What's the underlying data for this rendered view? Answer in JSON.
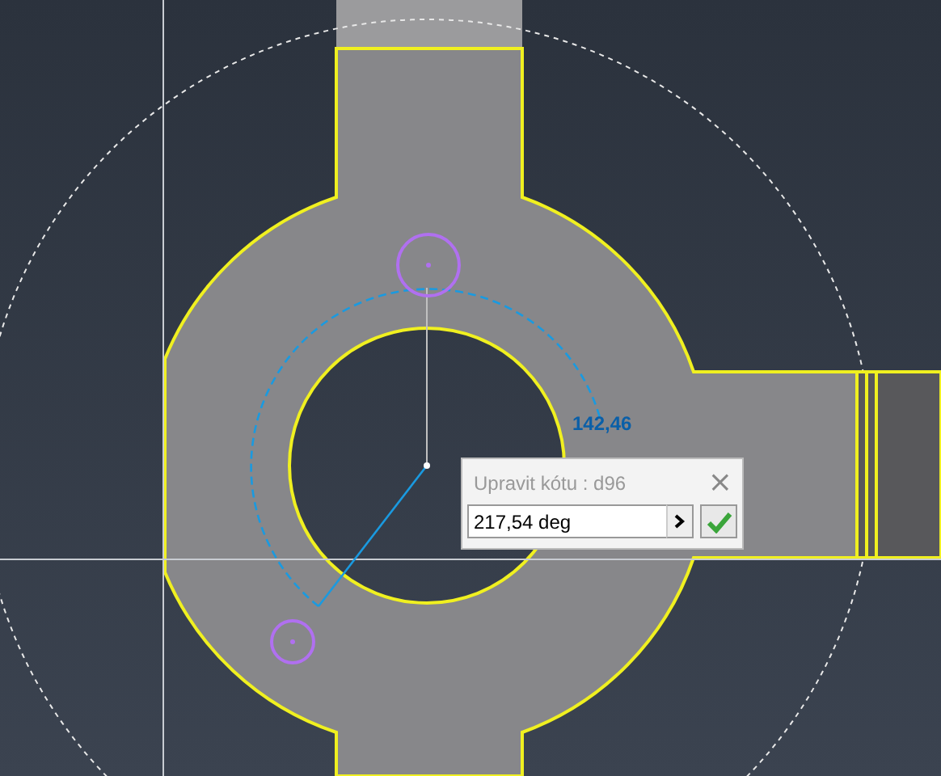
{
  "sketch": {
    "dimension_label": "142,46"
  },
  "dialog": {
    "title": "Upravit kótu : d96",
    "close": "×",
    "value": "217,54 deg"
  }
}
